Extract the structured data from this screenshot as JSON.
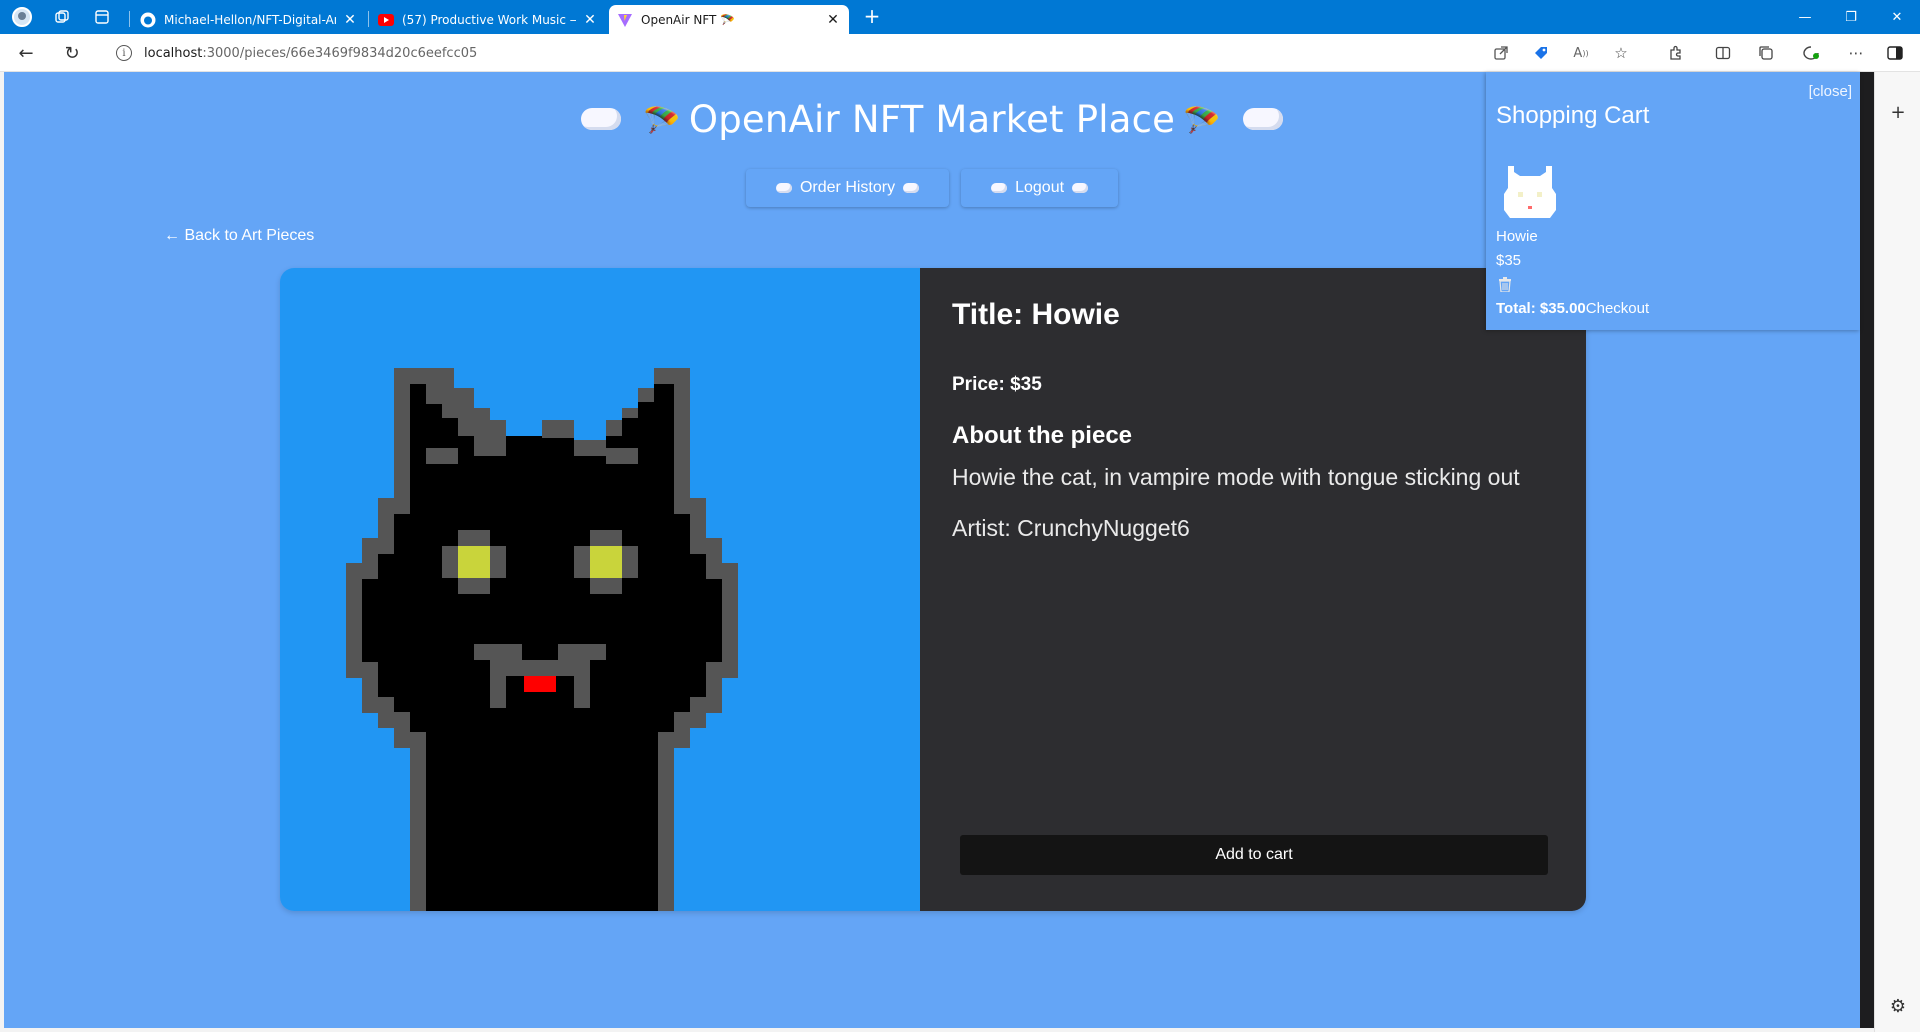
{
  "browser": {
    "tabs": [
      {
        "label": "Michael-Hellon/NFT-Digital-Art-M",
        "icon": "github-icon"
      },
      {
        "label": "(57) Productive Work Music — De",
        "icon": "youtube-icon"
      },
      {
        "label": "OpenAir NFT 🪂",
        "icon": "vite-icon",
        "active": true
      }
    ],
    "url_host": "localhost",
    "url_path": ":3000/pieces/66e3469f9834d20c6eefcc05"
  },
  "page": {
    "title": "OpenAir NFT Market Place",
    "title_emoji": "🪂",
    "nav": {
      "order_history": "Order History",
      "logout": "Logout"
    },
    "back_link": "← Back to Art Pieces"
  },
  "piece": {
    "title": "Title: Howie",
    "price": "Price: $35",
    "about_heading": "About the piece",
    "description": "Howie the cat, in vampire mode with tongue sticking out",
    "artist": "Artist: CrunchyNugget6",
    "add_to_cart": "Add to cart"
  },
  "cart": {
    "close": "[close]",
    "title": "Shopping Cart",
    "items": [
      {
        "name": "Howie",
        "price": "$35",
        "remove_icon": "trash-icon"
      }
    ],
    "total": "Total: $35.00",
    "checkout": "Checkout"
  },
  "colors": {
    "page_bg": "#64a5f6",
    "image_bg": "#2196f3",
    "info_bg": "#2d2d30",
    "browser_accent": "#0078d4"
  }
}
